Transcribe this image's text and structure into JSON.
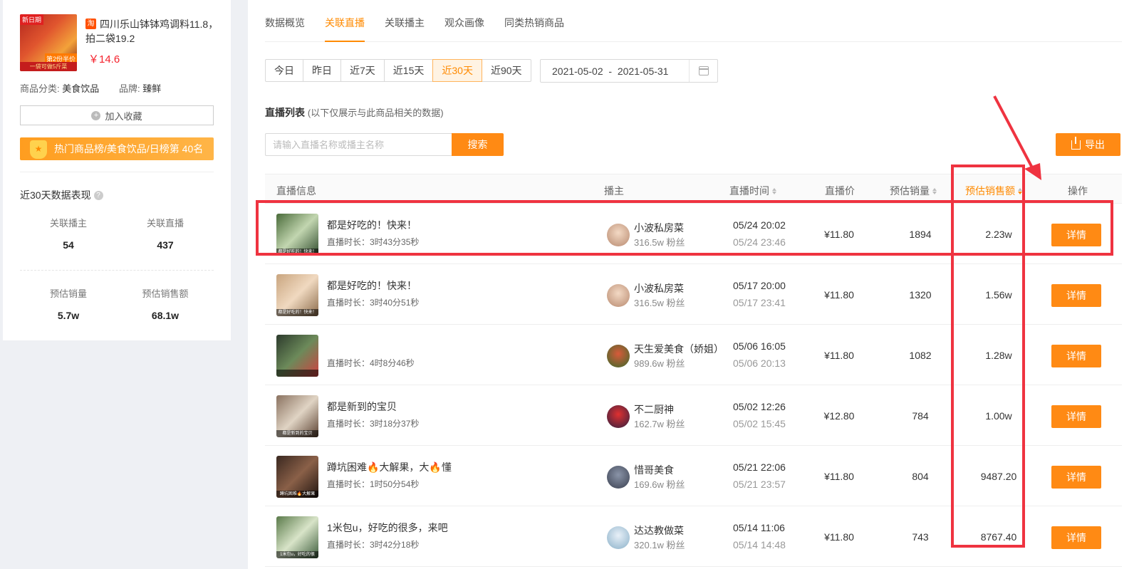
{
  "product": {
    "image_tag_top": "新日期",
    "image_tag_bottom": "一袋可做5斤菜",
    "image_tag_side": "第2份半价",
    "title": "四川乐山钵钵鸡调料11.8，拍二袋19.2",
    "platform_icon": "淘",
    "price": "￥14.6",
    "category_label": "商品分类:",
    "category_value": "美食饮品",
    "brand_label": "品牌:",
    "brand_value": "臻鲜",
    "favorite_label": "加入收藏",
    "rank_text": "热门商品榜/美食饮品/日榜第 40名"
  },
  "stats": {
    "title": "近30天数据表现",
    "help_icon": "?",
    "items": [
      {
        "label": "关联播主",
        "value": "54"
      },
      {
        "label": "关联直播",
        "value": "437"
      },
      {
        "label": "预估销量",
        "value": "5.7w"
      },
      {
        "label": "预估销售额",
        "value": "68.1w"
      }
    ]
  },
  "tabs": [
    "数据概览",
    "关联直播",
    "关联播主",
    "观众画像",
    "同类热销商品"
  ],
  "active_tab": 1,
  "ranges": [
    "今日",
    "昨日",
    "近7天",
    "近15天",
    "近30天",
    "近90天"
  ],
  "active_range": 4,
  "date_range": {
    "start": "2021-05-02",
    "separator": "-",
    "end": "2021-05-31"
  },
  "list": {
    "title": "直播列表",
    "note": "(以下仅展示与此商品相关的数据)",
    "search_placeholder": "请输入直播名称或播主名称",
    "search_label": "搜索",
    "export_label": "导出"
  },
  "table": {
    "headers": {
      "info": "直播信息",
      "anchor": "播主",
      "time": "直播时间",
      "price": "直播价",
      "sales": "预估销量",
      "amount": "预估销售额",
      "action": "操作"
    },
    "detail_label": "详情",
    "rows": [
      {
        "title": "都是好吃的！快来！",
        "duration": "直播时长：3时43分35秒",
        "thumb_caption": "都是好吃的！快来！",
        "anchor": "小波私房菜",
        "fans": "316.5w 粉丝",
        "start": "05/24 20:02",
        "end": "05/24 23:46",
        "price": "¥11.80",
        "sales": "1894",
        "amount": "2.23w"
      },
      {
        "title": "都是好吃的！快来！",
        "duration": "直播时长：3时40分51秒",
        "thumb_caption": "都是好吃的！快来！",
        "anchor": "小波私房菜",
        "fans": "316.5w 粉丝",
        "start": "05/17 20:00",
        "end": "05/17 23:41",
        "price": "¥11.80",
        "sales": "1320",
        "amount": "1.56w"
      },
      {
        "title": "",
        "duration": "直播时长：4时8分46秒",
        "thumb_caption": "",
        "anchor": "天生爱美食（娇姐）",
        "fans": "989.6w 粉丝",
        "start": "05/06 16:05",
        "end": "05/06 20:13",
        "price": "¥11.80",
        "sales": "1082",
        "amount": "1.28w"
      },
      {
        "title": "都是新到的宝贝",
        "duration": "直播时长：3时18分37秒",
        "thumb_caption": "都是新到的宝贝",
        "anchor": "不二厨神",
        "fans": "162.7w 粉丝",
        "start": "05/02 12:26",
        "end": "05/02 15:45",
        "price": "¥12.80",
        "sales": "784",
        "amount": "1.00w"
      },
      {
        "title": "蹲坑困难🔥大解果，大🔥懂",
        "duration": "直播时长：1时50分54秒",
        "thumb_caption": "蹲坑困难🔥大解果",
        "anchor": "惜哥美食",
        "fans": "169.6w 粉丝",
        "start": "05/21 22:06",
        "end": "05/21 23:57",
        "price": "¥11.80",
        "sales": "804",
        "amount": "9487.20"
      },
      {
        "title": "1米包u，好吃的很多，来吧",
        "duration": "直播时长：3时42分18秒",
        "thumb_caption": "1米包u，好吃的很",
        "anchor": "达达教做菜",
        "fans": "320.1w 粉丝",
        "start": "05/14 11:06",
        "end": "05/14 14:48",
        "price": "¥11.80",
        "sales": "743",
        "amount": "8767.40"
      }
    ]
  },
  "colors": {
    "accent": "#ff8a14",
    "annotation": "#ef3340",
    "price_red": "#f5222d"
  }
}
